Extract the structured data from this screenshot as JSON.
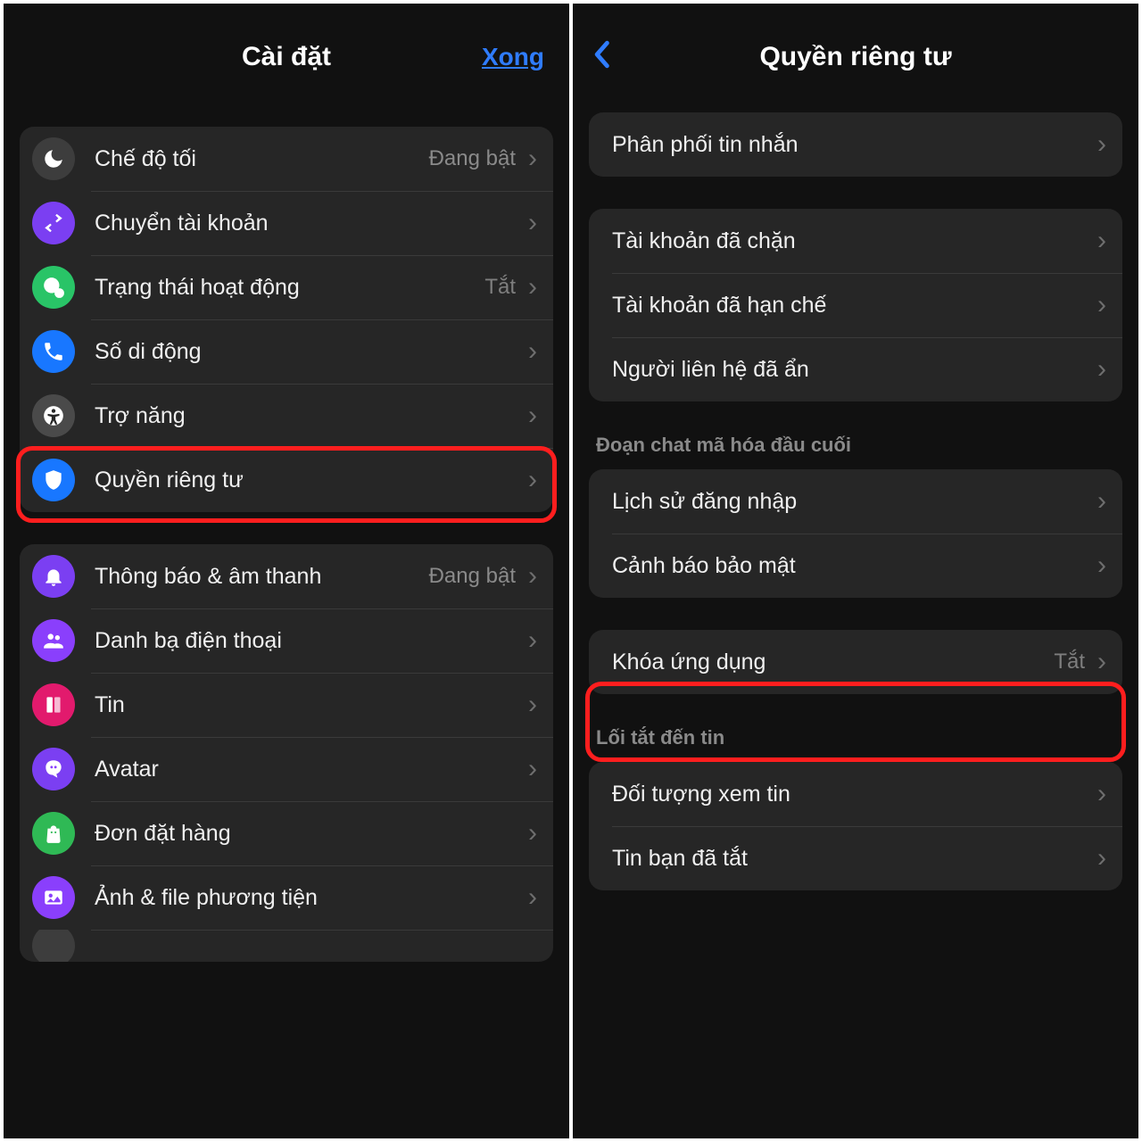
{
  "left": {
    "title": "Cài đặt",
    "done": "Xong",
    "group1": [
      {
        "label": "Chế độ tối",
        "value": "Đang bật"
      },
      {
        "label": "Chuyển tài khoản"
      },
      {
        "label": "Trạng thái hoạt động",
        "value": "Tắt"
      },
      {
        "label": "Số di động"
      },
      {
        "label": "Trợ năng"
      },
      {
        "label": "Quyền riêng tư"
      }
    ],
    "group2": [
      {
        "label": "Thông báo & âm thanh",
        "value": "Đang bật"
      },
      {
        "label": "Danh bạ điện thoại"
      },
      {
        "label": "Tin"
      },
      {
        "label": "Avatar"
      },
      {
        "label": "Đơn đặt hàng"
      },
      {
        "label": "Ảnh & file phương tiện"
      }
    ]
  },
  "right": {
    "title": "Quyền riêng tư",
    "group1": [
      {
        "label": "Phân phối tin nhắn"
      }
    ],
    "group2": [
      {
        "label": "Tài khoản đã chặn"
      },
      {
        "label": "Tài khoản đã hạn chế"
      },
      {
        "label": "Người liên hệ đã ẩn"
      }
    ],
    "section_e2e": "Đoạn chat mã hóa đầu cuối",
    "group3": [
      {
        "label": "Lịch sử đăng nhập"
      },
      {
        "label": "Cảnh báo bảo mật"
      }
    ],
    "group4": [
      {
        "label": "Khóa ứng dụng",
        "value": "Tắt"
      }
    ],
    "section_shortcut": "Lối tắt đến tin",
    "group5": [
      {
        "label": "Đối tượng xem tin"
      },
      {
        "label": "Tin bạn đã tắt"
      }
    ]
  }
}
